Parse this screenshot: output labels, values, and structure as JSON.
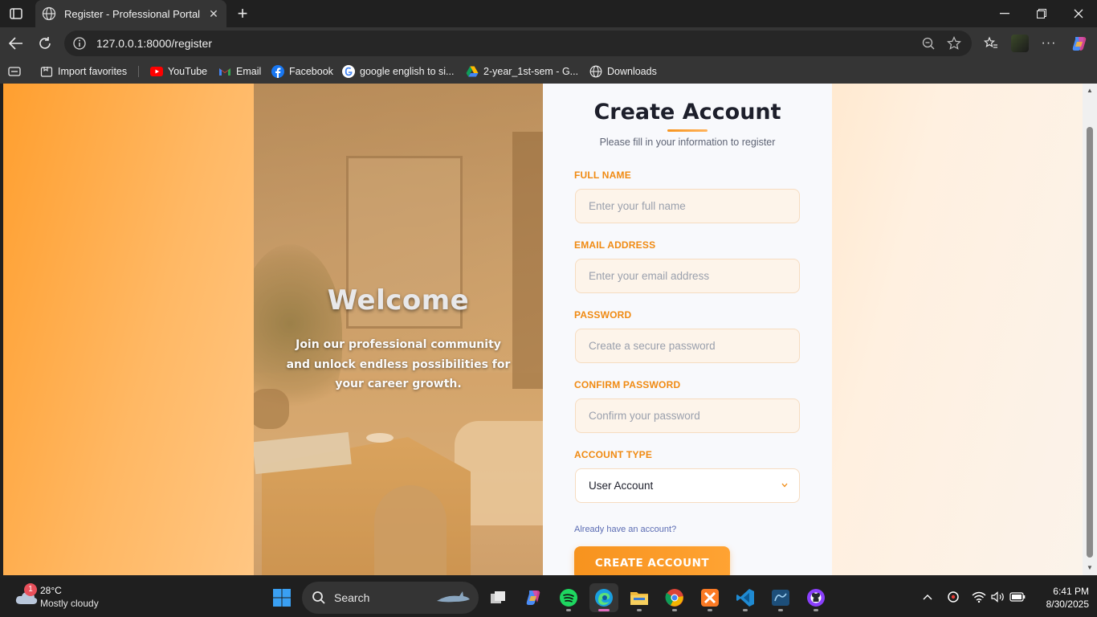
{
  "browser": {
    "tab_title": "Register - Professional Portal",
    "url": "127.0.0.1:8000/register",
    "favorites": [
      {
        "label": "Import favorites",
        "icon": "import-icon"
      },
      {
        "label": "YouTube",
        "icon": "youtube-icon"
      },
      {
        "label": "Email",
        "icon": "gmail-icon"
      },
      {
        "label": "Facebook",
        "icon": "facebook-icon"
      },
      {
        "label": "google english to si...",
        "icon": "google-icon"
      },
      {
        "label": "2-year_1st-sem - G...",
        "icon": "drive-icon"
      },
      {
        "label": "Downloads",
        "icon": "globe-icon"
      }
    ]
  },
  "hero": {
    "title": "Welcome",
    "tagline": "Join our professional community and unlock endless possibilities for your career growth."
  },
  "form": {
    "title": "Create Account",
    "subtitle": "Please fill in your information to register",
    "fields": [
      {
        "label": "FULL NAME",
        "placeholder": "Enter your full name"
      },
      {
        "label": "EMAIL ADDRESS",
        "placeholder": "Enter your email address"
      },
      {
        "label": "PASSWORD",
        "placeholder": "Create a secure password"
      },
      {
        "label": "CONFIRM PASSWORD",
        "placeholder": "Confirm your password"
      }
    ],
    "account_type": {
      "label": "ACCOUNT TYPE",
      "value": "User Account"
    },
    "signin_link": "Already have an account?",
    "submit": "CREATE ACCOUNT",
    "accent_color": "#f7931e"
  },
  "taskbar": {
    "weather": {
      "badge": "1",
      "temp": "28°C",
      "condition": "Mostly cloudy"
    },
    "search_label": "Search",
    "time": "6:41 PM",
    "date": "8/30/2025"
  }
}
